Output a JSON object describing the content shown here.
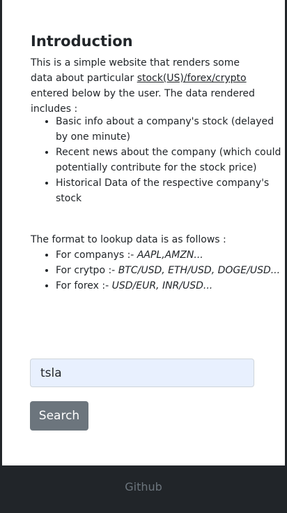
{
  "intro": {
    "title": "Introduction",
    "text_before": "This is a simple website that renders some data about particular ",
    "link_text": "stock(US)/forex/crypto",
    "text_after": " entered below by the user. The data rendered includes :",
    "features": [
      "Basic info about a company's stock (delayed by one minute)",
      "Recent news about the company (which could potentially contribute for the stock price)",
      "Historical Data of the respective company's stock"
    ]
  },
  "format": {
    "heading": "The format to lookup data is as follows :",
    "items": [
      {
        "label": "For companys :- ",
        "example": "AAPL,AMZN..."
      },
      {
        "label": "For crytpo :- ",
        "example": "BTC/USD, ETH/USD, DOGE/USD..."
      },
      {
        "label": "For forex :- ",
        "example": "USD/EUR, INR/USD..."
      }
    ]
  },
  "search": {
    "value": "tsla",
    "button_label": "Search"
  },
  "footer": {
    "link_label": "Github"
  },
  "colors": {
    "button_bg": "#6c757d",
    "input_bg": "#e8f0fe",
    "footer_bg": "#212529"
  }
}
